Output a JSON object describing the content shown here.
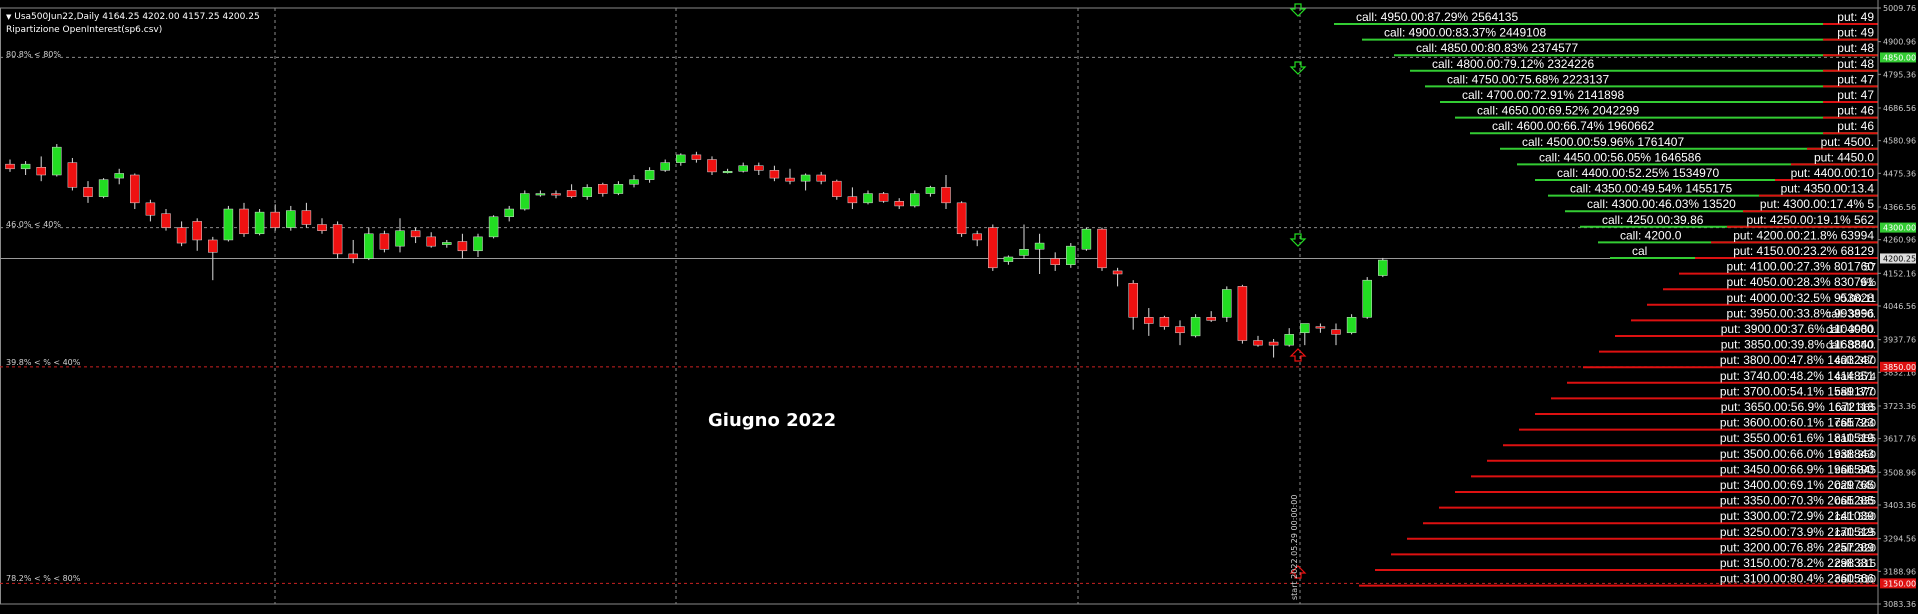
{
  "header": {
    "symbol_line": "Usa500Jun22,Daily  4164.25 4202.00 4157.25 4200.25",
    "indicator": "Ripartizione OpenInterest(sp6.csv)"
  },
  "annotations": {
    "level_80": "80.8% < 80%",
    "level_40": "46.0% < 40%",
    "level_low40": "39.8% < % < 40%",
    "level_low80": "78.2% < % < 80%"
  },
  "period_label": "Giugno 2022",
  "start_label": "start 2022.05.29 00:00:00",
  "colors": {
    "background": "#000000",
    "bull": "#22dd22",
    "bear": "#ee1111",
    "call_bar": "#33cc33",
    "put_bar": "#dd1111",
    "grid": "#8a8a8a"
  },
  "chart_data": {
    "type": "candlestick",
    "ylim": [
      3083.36,
      5009.76
    ],
    "y_ticks": [
      "5009.76",
      "4900.96",
      "4795.36",
      "4686.56",
      "4580.96",
      "4475.36",
      "4366.56",
      "4260.96",
      "4152.16",
      "4046.56",
      "3937.76",
      "3832.16",
      "3723.36",
      "3617.76",
      "3508.96",
      "3403.36",
      "3294.56",
      "3188.96",
      "3083.36"
    ],
    "price_markers": [
      {
        "label": "4850.00",
        "color": "#33cc33"
      },
      {
        "label": "4300.00",
        "color": "#33cc33"
      },
      {
        "label": "4200.25",
        "color": "#dddddd"
      },
      {
        "label": "3850.00",
        "color": "#dd1111"
      },
      {
        "label": "3150.00",
        "color": "#dd1111"
      }
    ],
    "candles": [
      {
        "o": 4505,
        "h": 4520,
        "l": 4480,
        "c": 4490
      },
      {
        "o": 4490,
        "h": 4515,
        "l": 4470,
        "c": 4505
      },
      {
        "o": 4495,
        "h": 4530,
        "l": 4450,
        "c": 4470
      },
      {
        "o": 4470,
        "h": 4570,
        "l": 4465,
        "c": 4560
      },
      {
        "o": 4510,
        "h": 4525,
        "l": 4420,
        "c": 4430
      },
      {
        "o": 4430,
        "h": 4450,
        "l": 4380,
        "c": 4400
      },
      {
        "o": 4400,
        "h": 4460,
        "l": 4395,
        "c": 4455
      },
      {
        "o": 4460,
        "h": 4490,
        "l": 4440,
        "c": 4475
      },
      {
        "o": 4470,
        "h": 4475,
        "l": 4360,
        "c": 4380
      },
      {
        "o": 4380,
        "h": 4390,
        "l": 4320,
        "c": 4340
      },
      {
        "o": 4345,
        "h": 4360,
        "l": 4290,
        "c": 4300
      },
      {
        "o": 4300,
        "h": 4320,
        "l": 4240,
        "c": 4250
      },
      {
        "o": 4320,
        "h": 4330,
        "l": 4225,
        "c": 4260
      },
      {
        "o": 4260,
        "h": 4270,
        "l": 4130,
        "c": 4220
      },
      {
        "o": 4260,
        "h": 4370,
        "l": 4255,
        "c": 4360
      },
      {
        "o": 4360,
        "h": 4380,
        "l": 4270,
        "c": 4280
      },
      {
        "o": 4280,
        "h": 4360,
        "l": 4275,
        "c": 4350
      },
      {
        "o": 4350,
        "h": 4375,
        "l": 4290,
        "c": 4300
      },
      {
        "o": 4300,
        "h": 4370,
        "l": 4290,
        "c": 4355
      },
      {
        "o": 4355,
        "h": 4380,
        "l": 4300,
        "c": 4310
      },
      {
        "o": 4310,
        "h": 4330,
        "l": 4280,
        "c": 4290
      },
      {
        "o": 4310,
        "h": 4320,
        "l": 4200,
        "c": 4215
      },
      {
        "o": 4215,
        "h": 4260,
        "l": 4185,
        "c": 4200
      },
      {
        "o": 4200,
        "h": 4300,
        "l": 4195,
        "c": 4280
      },
      {
        "o": 4280,
        "h": 4290,
        "l": 4220,
        "c": 4230
      },
      {
        "o": 4240,
        "h": 4330,
        "l": 4220,
        "c": 4290
      },
      {
        "o": 4290,
        "h": 4300,
        "l": 4250,
        "c": 4270
      },
      {
        "o": 4270,
        "h": 4285,
        "l": 4235,
        "c": 4240
      },
      {
        "o": 4245,
        "h": 4260,
        "l": 4235,
        "c": 4252
      },
      {
        "o": 4255,
        "h": 4280,
        "l": 4200,
        "c": 4225
      },
      {
        "o": 4225,
        "h": 4280,
        "l": 4205,
        "c": 4270
      },
      {
        "o": 4270,
        "h": 4340,
        "l": 4265,
        "c": 4335
      },
      {
        "o": 4335,
        "h": 4370,
        "l": 4320,
        "c": 4360
      },
      {
        "o": 4360,
        "h": 4420,
        "l": 4355,
        "c": 4410
      },
      {
        "o": 4410,
        "h": 4420,
        "l": 4400,
        "c": 4410
      },
      {
        "o": 4410,
        "h": 4420,
        "l": 4395,
        "c": 4405
      },
      {
        "o": 4420,
        "h": 4440,
        "l": 4395,
        "c": 4400
      },
      {
        "o": 4400,
        "h": 4440,
        "l": 4390,
        "c": 4430
      },
      {
        "o": 4440,
        "h": 4445,
        "l": 4400,
        "c": 4410
      },
      {
        "o": 4410,
        "h": 4450,
        "l": 4405,
        "c": 4440
      },
      {
        "o": 4440,
        "h": 4470,
        "l": 4430,
        "c": 4455
      },
      {
        "o": 4455,
        "h": 4495,
        "l": 4445,
        "c": 4485
      },
      {
        "o": 4485,
        "h": 4520,
        "l": 4480,
        "c": 4510
      },
      {
        "o": 4510,
        "h": 4540,
        "l": 4500,
        "c": 4535
      },
      {
        "o": 4535,
        "h": 4545,
        "l": 4510,
        "c": 4520
      },
      {
        "o": 4520,
        "h": 4530,
        "l": 4470,
        "c": 4480
      },
      {
        "o": 4480,
        "h": 4490,
        "l": 4475,
        "c": 4482
      },
      {
        "o": 4482,
        "h": 4510,
        "l": 4478,
        "c": 4500
      },
      {
        "o": 4500,
        "h": 4510,
        "l": 4470,
        "c": 4485
      },
      {
        "o": 4485,
        "h": 4500,
        "l": 4450,
        "c": 4460
      },
      {
        "o": 4460,
        "h": 4490,
        "l": 4440,
        "c": 4450
      },
      {
        "o": 4450,
        "h": 4475,
        "l": 4420,
        "c": 4470
      },
      {
        "o": 4470,
        "h": 4480,
        "l": 4440,
        "c": 4450
      },
      {
        "o": 4450,
        "h": 4455,
        "l": 4390,
        "c": 4400
      },
      {
        "o": 4400,
        "h": 4430,
        "l": 4360,
        "c": 4380
      },
      {
        "o": 4380,
        "h": 4420,
        "l": 4375,
        "c": 4410
      },
      {
        "o": 4410,
        "h": 4415,
        "l": 4380,
        "c": 4385
      },
      {
        "o": 4385,
        "h": 4395,
        "l": 4360,
        "c": 4370
      },
      {
        "o": 4370,
        "h": 4420,
        "l": 4365,
        "c": 4410
      },
      {
        "o": 4410,
        "h": 4435,
        "l": 4400,
        "c": 4430
      },
      {
        "o": 4430,
        "h": 4470,
        "l": 4360,
        "c": 4380
      },
      {
        "o": 4380,
        "h": 4385,
        "l": 4270,
        "c": 4280
      },
      {
        "o": 4280,
        "h": 4290,
        "l": 4240,
        "c": 4260
      },
      {
        "o": 4300,
        "h": 4310,
        "l": 4160,
        "c": 4170
      },
      {
        "o": 4190,
        "h": 4210,
        "l": 4180,
        "c": 4205
      },
      {
        "o": 4210,
        "h": 4310,
        "l": 4200,
        "c": 4230
      },
      {
        "o": 4230,
        "h": 4280,
        "l": 4150,
        "c": 4250
      },
      {
        "o": 4200,
        "h": 4220,
        "l": 4160,
        "c": 4180
      },
      {
        "o": 4180,
        "h": 4250,
        "l": 4170,
        "c": 4240
      },
      {
        "o": 4230,
        "h": 4300,
        "l": 4225,
        "c": 4295
      },
      {
        "o": 4295,
        "h": 4300,
        "l": 4160,
        "c": 4170
      },
      {
        "o": 4160,
        "h": 4170,
        "l": 4110,
        "c": 4150
      },
      {
        "o": 4120,
        "h": 4130,
        "l": 3970,
        "c": 4010
      },
      {
        "o": 4010,
        "h": 4040,
        "l": 3950,
        "c": 3990
      },
      {
        "o": 4010,
        "h": 4015,
        "l": 3970,
        "c": 3980
      },
      {
        "o": 3980,
        "h": 4000,
        "l": 3920,
        "c": 3960
      },
      {
        "o": 3950,
        "h": 4020,
        "l": 3945,
        "c": 4010
      },
      {
        "o": 4010,
        "h": 4030,
        "l": 3995,
        "c": 4000
      },
      {
        "o": 4010,
        "h": 4110,
        "l": 3995,
        "c": 4100
      },
      {
        "o": 4110,
        "h": 4115,
        "l": 3925,
        "c": 3935
      },
      {
        "o": 3935,
        "h": 3950,
        "l": 3915,
        "c": 3920
      },
      {
        "o": 3930,
        "h": 3940,
        "l": 3880,
        "c": 3920
      },
      {
        "o": 3920,
        "h": 3975,
        "l": 3915,
        "c": 3955
      },
      {
        "o": 3960,
        "h": 3990,
        "l": 3920,
        "c": 3990
      },
      {
        "o": 3980,
        "h": 3990,
        "l": 3960,
        "c": 3975
      },
      {
        "o": 3970,
        "h": 3990,
        "l": 3920,
        "c": 3955
      },
      {
        "o": 3960,
        "h": 4020,
        "l": 3955,
        "c": 4010
      },
      {
        "o": 4010,
        "h": 4140,
        "l": 4005,
        "c": 4130
      },
      {
        "o": 4145,
        "h": 4202,
        "l": 4140,
        "c": 4195
      }
    ],
    "oi_calls": [
      "call: 4950.00:87.29% 2564135",
      "call: 4900.00:83.37% 2449108",
      "call: 4850.00:80.83% 2374577",
      "call: 4800.00:79.12% 2324226",
      "call: 4750.00:75.68% 2223137",
      "call: 4700.00:72.91% 2141898",
      "call: 4650.00:69.52% 2042299",
      "call: 4600.00:66.74% 1960662",
      "call: 4500.00:59.96% 1761407",
      "call: 4450.00:56.05% 1646586",
      "call: 4400.00:52.25% 1534970",
      "call: 4350.00:49.54% 1455175",
      "call: 4300.00:46.03% 13520",
      "call: 4250.00:39.86",
      "call: 4200.0",
      "cal"
    ],
    "oi_puts": [
      "put: 49",
      "put: 49",
      "put: 48",
      "put: 48",
      "put: 47",
      "put: 47",
      "put: 46",
      "put: 46",
      "put: 4500.",
      "put: 4450.0",
      "put: 4400.00:10",
      "put: 4350.00:13.4",
      "put: 4300.00:17.4% 5",
      "put: 4250.00:19.1% 562",
      "put: 4200.00:21.8% 63994",
      "put: 4150.00:23.2% 68129",
      "put: 4100.00:27.3% 801760",
      "put: 4050.00:28.3% 830761",
      "put: 4000.00:32.5% 953828",
      "put: 3950.00:33.8% 993896",
      "put: 3900.00:37.6% 1104080",
      "put: 3850.00:39.8% 1168840",
      "put: 3800.00:47.8% 1403247",
      "put: 3740.00:48.2% 1414851",
      "put: 3700.00:54.1% 1589177",
      "put: 3650.00:56.9% 1672118",
      "put: 3600.00:60.1% 1765723",
      "put: 3550.00:61.6% 1810519",
      "put: 3500.00:66.0% 1938843",
      "put: 3450.00:66.9% 1966590",
      "put: 3400.00:69.1% 2029765",
      "put: 3350.00:70.3% 2065285",
      "put: 3300.00:72.9% 2141039",
      "put: 3250.00:73.9% 2170519",
      "put: 3200.00:76.8% 2257289",
      "put: 3150.00:78.2% 2298331",
      "put: 3100.00:80.4% 2360566"
    ],
    "oi_calls_low": [
      "57",
      "9%",
      "0.00:11",
      "call: 3950.",
      "call: 3900.",
      "call: 3850.",
      "call: 380",
      "call: 374",
      "call: 370",
      "call: 365",
      "call: 360",
      "call: 355",
      "call: 350",
      "call: 345",
      "call: 340",
      "call: 335",
      "call: 330",
      "call: 325",
      "call: 320",
      "call: 315",
      "call: 310"
    ]
  }
}
